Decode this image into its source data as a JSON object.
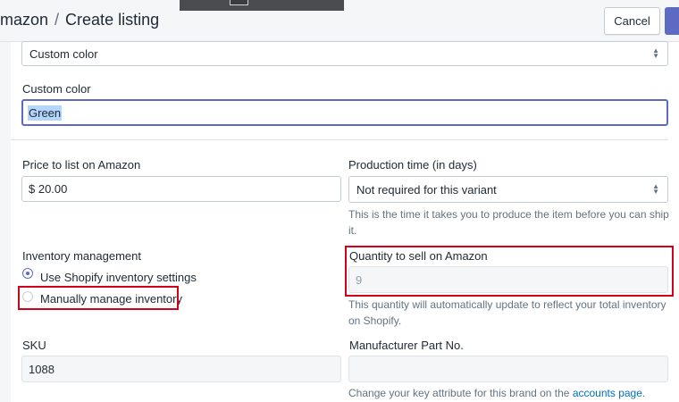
{
  "header": {
    "app": "mazon",
    "separator": "/",
    "title": "Create listing",
    "cancel_label": "Cancel"
  },
  "form": {
    "color_select": {
      "value": "Custom color"
    },
    "custom_color": {
      "label": "Custom color",
      "value": "Green"
    },
    "price": {
      "label": "Price to list on Amazon",
      "value": "$ 20.00"
    },
    "production_time": {
      "label": "Production time (in days)",
      "value": "Not required for this variant",
      "help": "This is the time it takes you to produce the item before you can ship it."
    },
    "inventory": {
      "label": "Inventory management",
      "options": [
        {
          "label": "Use Shopify inventory settings",
          "checked": true
        },
        {
          "label": "Manually manage inventory",
          "checked": false
        }
      ]
    },
    "quantity": {
      "label": "Quantity to sell on Amazon",
      "value": "9",
      "help": "This quantity will automatically update to reflect your total inventory on Shopify."
    },
    "sku": {
      "label": "SKU",
      "value": "1088"
    },
    "mpn": {
      "label": "Manufacturer Part No.",
      "value": "",
      "help_prefix": "Change your key attribute for this brand on the",
      "help_link": "accounts page",
      "help_suffix": "."
    }
  },
  "colors": {
    "accent": "#5c6ac4",
    "highlight_red": "#d0021b",
    "link": "#006fbb",
    "selection": "#b4d5fe"
  }
}
